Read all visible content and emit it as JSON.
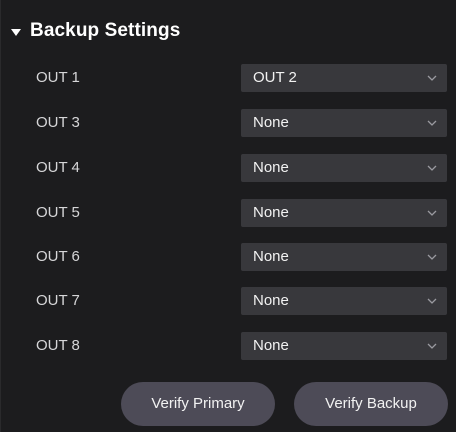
{
  "section": {
    "title": "Backup Settings",
    "collapse_icon": "triangle-down-icon"
  },
  "rows": [
    {
      "label": "OUT 1",
      "value": "OUT 2"
    },
    {
      "label": "OUT 3",
      "value": "None"
    },
    {
      "label": "OUT 4",
      "value": "None"
    },
    {
      "label": "OUT 5",
      "value": "None"
    },
    {
      "label": "OUT 6",
      "value": "None"
    },
    {
      "label": "OUT 7",
      "value": "None"
    },
    {
      "label": "OUT 8",
      "value": "None"
    }
  ],
  "buttons": {
    "verify_primary": "Verify Primary",
    "verify_backup": "Verify Backup"
  },
  "colors": {
    "background": "#1c1c1e",
    "select_bg": "#38383c",
    "button_bg": "#4d4b57",
    "text": "#ffffff"
  }
}
